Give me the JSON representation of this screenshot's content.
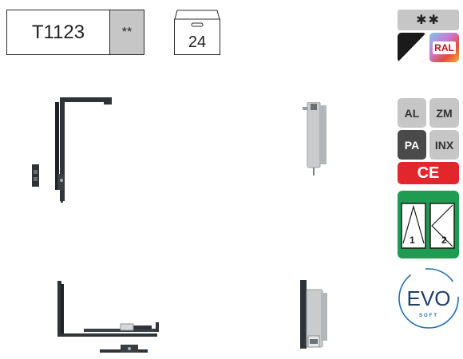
{
  "product": {
    "code": "T1123",
    "grade": "**"
  },
  "package": {
    "quantity": "24"
  },
  "badges": {
    "stars": "✱✱",
    "ral": "RAL",
    "al": "AL",
    "zm": "ZM",
    "pa": "PA",
    "inx": "INX",
    "ce": "CE",
    "tilt_1": "1",
    "tilt_2": "2",
    "evo": "EVO",
    "evo_sub": "SOFT"
  },
  "colors": {
    "grey_badge": "#c6c6c6",
    "dark_badge": "#4a4a4a",
    "ce_red": "#e3262c",
    "evo_blue": "#1f6fb5",
    "tilt_green": "#1f9b52",
    "hardware_dark": "#3a3f44",
    "hardware_silver": "#c9cbcd"
  }
}
